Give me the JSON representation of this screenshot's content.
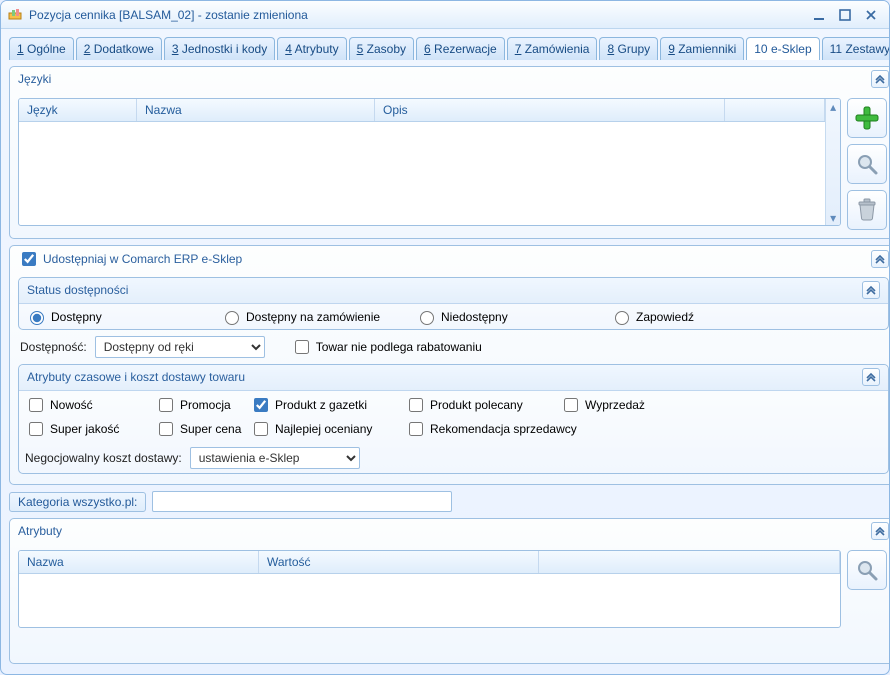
{
  "colors": {
    "accent": "#2a5f9e",
    "border": "#9ec0e2"
  },
  "window": {
    "title": "Pozycja cennika [BALSAM_02] - zostanie zmieniona"
  },
  "tabs": [
    {
      "num": "1",
      "label": "Ogólne"
    },
    {
      "num": "2",
      "label": "Dodatkowe"
    },
    {
      "num": "3",
      "label": "Jednostki i kody"
    },
    {
      "num": "4",
      "label": "Atrybuty"
    },
    {
      "num": "5",
      "label": "Zasoby"
    },
    {
      "num": "6",
      "label": "Rezerwacje"
    },
    {
      "num": "7",
      "label": "Zamówienia"
    },
    {
      "num": "8",
      "label": "Grupy"
    },
    {
      "num": "9",
      "label": "Zamienniki"
    },
    {
      "num": "10",
      "label": "e-Sklep",
      "active": true
    },
    {
      "num": "11",
      "label": "Zestawy"
    }
  ],
  "languages": {
    "title": "Języki",
    "columns": {
      "lang": "Język",
      "name": "Nazwa",
      "desc": "Opis"
    }
  },
  "share": {
    "label": "Udostępniaj w Comarch ERP e-Sklep",
    "checked": true
  },
  "status": {
    "title": "Status dostępności",
    "options": {
      "available": "Dostępny",
      "onorder": "Dostępny na zamówienie",
      "unavailable": "Niedostępny",
      "announcement": "Zapowiedź"
    },
    "selected": "available",
    "availLabel": "Dostępność:",
    "availValue": "Dostępny od ręki",
    "noRebateLabel": "Towar nie podlega rabatowaniu",
    "noRebateChecked": false
  },
  "attr_time": {
    "title": "Atrybuty czasowe  i koszt dostawy towaru",
    "checks": {
      "novelty": "Nowość",
      "promo": "Promocja",
      "gazette": "Produkt z gazetki",
      "recommended": "Produkt polecany",
      "sale": "Wyprzedaż",
      "super_quality": "Super jakość",
      "super_price": "Super cena",
      "best_rated": "Najlepiej oceniany",
      "seller_rec": "Rekomendacja sprzedawcy"
    },
    "checked": {
      "gazette": true
    },
    "deliveryLabel": "Negocjowalny koszt dostawy:",
    "deliveryValue": "ustawienia e-Sklep"
  },
  "kategoria": {
    "label": "Kategoria wszystko.pl:",
    "value": ""
  },
  "attributes": {
    "title": "Atrybuty",
    "columns": {
      "name": "Nazwa",
      "value": "Wartość"
    }
  }
}
